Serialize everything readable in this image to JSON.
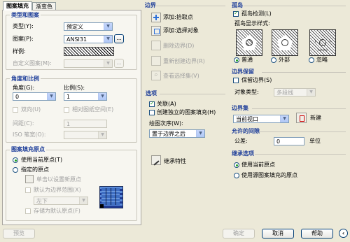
{
  "tabs": [
    "图案填充",
    "渐变色"
  ],
  "type_pattern": {
    "title": "类型和图案",
    "type_label": "类型(Y):",
    "type_value": "预定义",
    "pattern_label": "图案(P):",
    "pattern_value": "ANSI31",
    "swatch_label": "样例:",
    "custom_label": "自定义图案(M):"
  },
  "angle_scale": {
    "title": "角度和比例",
    "angle_label": "角度(G):",
    "angle_value": "0",
    "scale_label": "比例(S):",
    "scale_value": "1",
    "double_label": "双向(U)",
    "relative_label": "相对图纸空间(E)",
    "spacing_label": "间距(C):",
    "spacing_value": "1",
    "iso_label": "ISO 笔宽(O):"
  },
  "origin": {
    "title": "图案填充原点",
    "current_label": "使用当前原点(T)",
    "specified_label": "指定的原点",
    "click_set_label": "单击以设置新原点",
    "default_extent_label": "默认为边界范围(X)",
    "position_value": "左下",
    "store_label": "存储为默认原点(F)"
  },
  "boundary": {
    "title": "边界",
    "add_pick": "添加:拾取点",
    "add_select": "添加:选择对象",
    "remove": "删除边界(D)",
    "recreate": "重新创建边界(R)",
    "view": "查看选择集(V)"
  },
  "options": {
    "title": "选项",
    "associative": "关联(A)",
    "separate": "创建独立的图案填充(H)",
    "draw_order_label": "绘图次序(W):",
    "draw_order_value": "置于边界之后"
  },
  "inherit": "继承特性",
  "islands": {
    "title": "孤岛",
    "detect_label": "孤岛检测(L)",
    "style_label": "孤岛显示样式:",
    "styles": [
      "普通",
      "外部",
      "忽略"
    ]
  },
  "retain": {
    "title": "边界保留",
    "retain_label": "保留边界(S)",
    "object_type_label": "对象类型:",
    "object_type_value": "多段线"
  },
  "boundary_set": {
    "title": "边界集",
    "value": "当前视口",
    "new_label": "新建"
  },
  "gap": {
    "title": "允许的间隙",
    "tolerance_label": "公差:",
    "tolerance_value": "0",
    "unit": "单位"
  },
  "inherit_options": {
    "title": "继承选项",
    "current": "使用当前原点",
    "source": "使用源图案填充的原点"
  },
  "footer": {
    "preview": "预览",
    "ok": "确定",
    "cancel": "取消",
    "help": "帮助"
  }
}
